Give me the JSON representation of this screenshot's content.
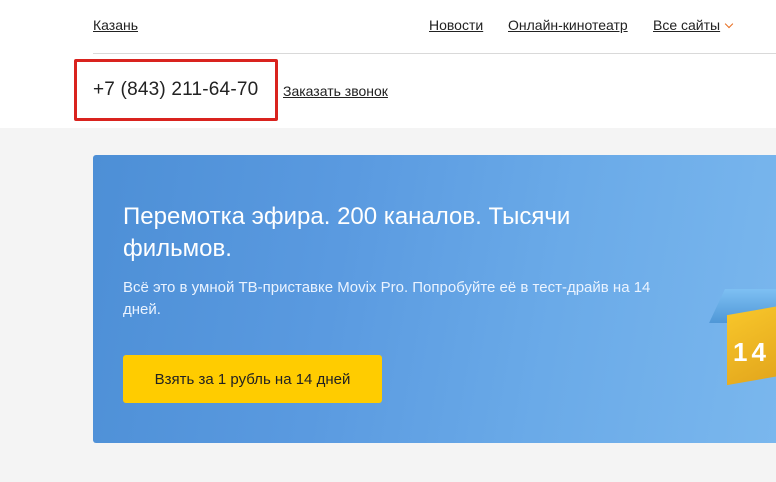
{
  "header": {
    "city": "Казань",
    "nav": {
      "news": "Новости",
      "cinema": "Онлайн-кинотеатр",
      "all_sites": "Все сайты"
    },
    "phone": "+7 (843) 211-64-70",
    "callback": "Заказать звонок"
  },
  "banner": {
    "title": "Перемотка эфира. 200 каналов. Тысячи фильмов.",
    "text": "Всё это в умной ТВ-приставке Movix Pro. Попробуйте её в тест-драйв на 14 дней.",
    "cta_label": "Взять за 1 рубль на 14 дней",
    "box_digits": "14"
  },
  "colors": {
    "accent": "#e86d1f",
    "highlight_border": "#d9231e",
    "cta": "#ffcc00",
    "banner_blue": "#5a9ae0"
  }
}
